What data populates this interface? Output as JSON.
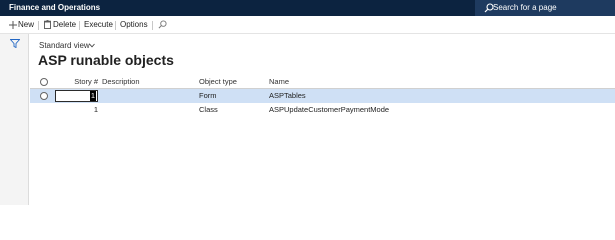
{
  "app": {
    "title": "Finance and Operations"
  },
  "search": {
    "label": "Search for a page"
  },
  "toolbar": {
    "new_label": "New",
    "delete_label": "Delete",
    "execute_label": "Execute",
    "options_label": "Options"
  },
  "view": {
    "label": "Standard view"
  },
  "page": {
    "title": "ASP runable objects"
  },
  "grid": {
    "columns": {
      "story": "Story #",
      "description": "Description",
      "object_type": "Object type",
      "name": "Name"
    },
    "rows": [
      {
        "story": "1",
        "description": "",
        "object_type": "Form",
        "name": "ASPTables",
        "selected": true
      },
      {
        "story": "1",
        "description": "",
        "object_type": "Class",
        "name": "ASPUpdateCustomerPaymentMode",
        "selected": false
      }
    ]
  },
  "colors": {
    "topbar": "#0c2340",
    "selected_row": "#cfe0f5",
    "accent": "#2266c4"
  },
  "icons": [
    "search-icon",
    "add-icon",
    "delete-icon",
    "toolbar-search-icon",
    "filter-icon",
    "chevron-down-icon"
  ]
}
